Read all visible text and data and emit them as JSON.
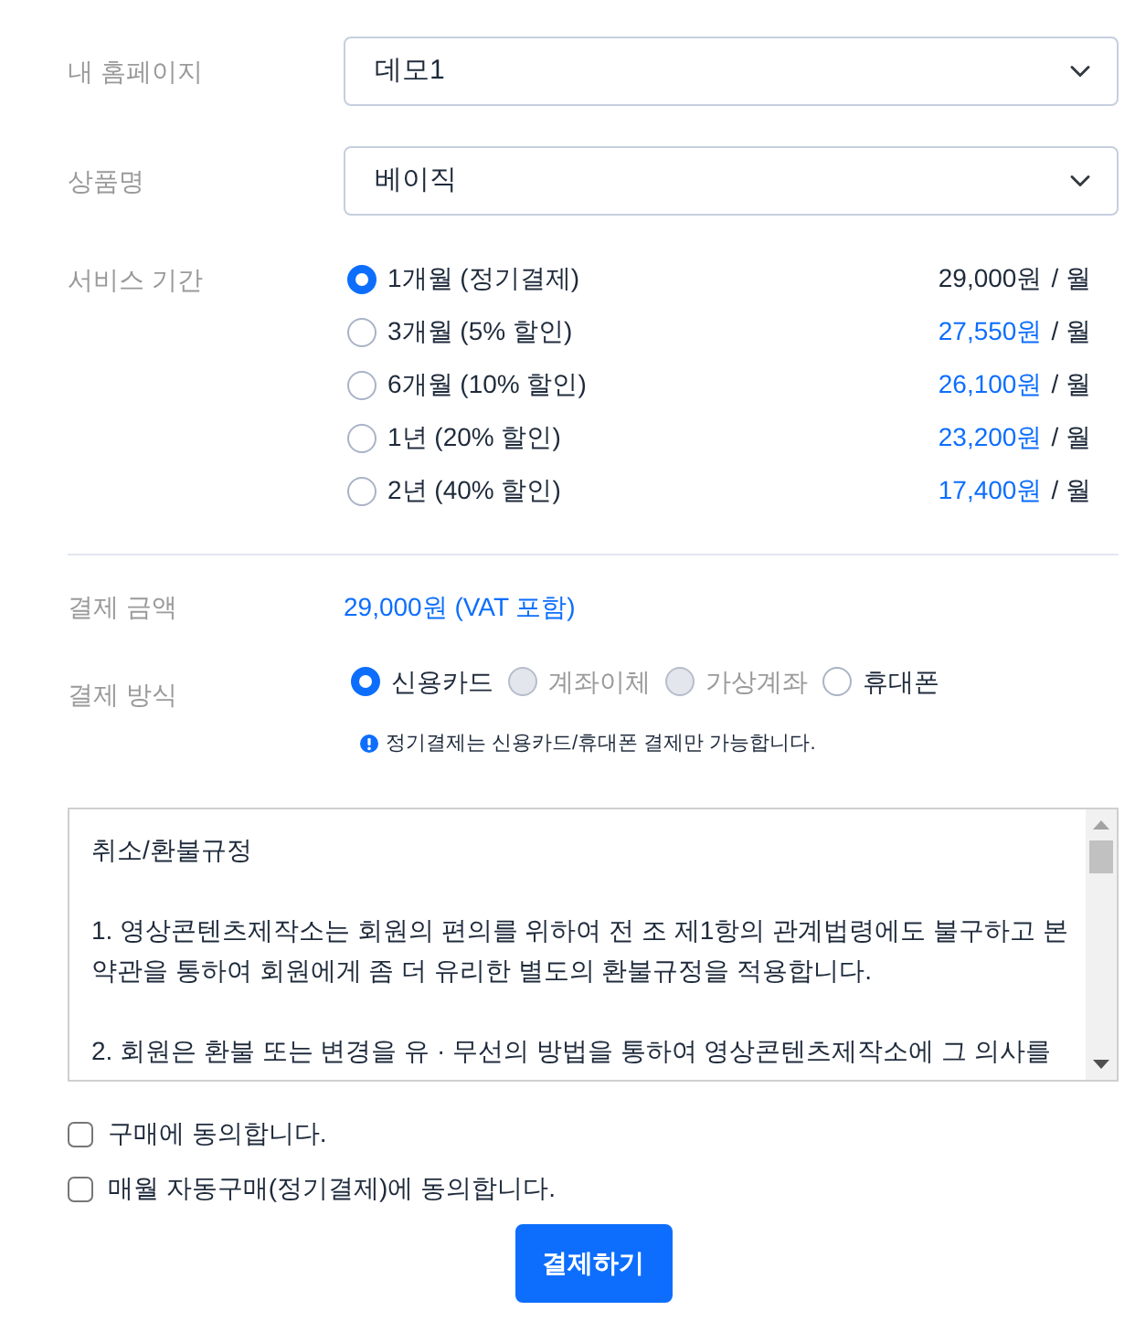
{
  "fields": [
    {
      "kind": "select",
      "label": "내 홈페이지",
      "value": "데모1"
    },
    {
      "kind": "select",
      "label": "상품명",
      "value": "베이직"
    }
  ],
  "service_period": {
    "label": "서비스 기간",
    "options": [
      {
        "label": "1개월 (정기결제)",
        "price": "29,000원",
        "unit": "/ 월",
        "color": "#1e2a3b",
        "selected": true
      },
      {
        "label": "3개월 (5% 할인)",
        "price": "27,550원",
        "unit": "/ 월",
        "color": "#0d6efd",
        "selected": false
      },
      {
        "label": "6개월 (10% 할인)",
        "price": "26,100원",
        "unit": "/ 월",
        "color": "#0d6efd",
        "selected": false
      },
      {
        "label": "1년 (20% 할인)",
        "price": "23,200원",
        "unit": "/ 월",
        "color": "#0d6efd",
        "selected": false
      },
      {
        "label": "2년 (40% 할인)",
        "price": "17,400원",
        "unit": "/ 월",
        "color": "#0d6efd",
        "selected": false
      }
    ]
  },
  "payment_amount": {
    "label": "결제 금액",
    "value": "29,000원 (VAT 포함)"
  },
  "payment_method": {
    "label": "결제 방식",
    "options": [
      {
        "label": "신용카드",
        "selected": true,
        "disabled": false
      },
      {
        "label": "계좌이체",
        "selected": false,
        "disabled": true
      },
      {
        "label": "가상계좌",
        "selected": false,
        "disabled": true
      },
      {
        "label": "휴대폰",
        "selected": false,
        "disabled": false
      }
    ],
    "notice": "정기결제는 신용카드/휴대폰 결제만 가능합니다."
  },
  "terms": {
    "title": "취소/환불규정",
    "paragraphs": [
      "1. 영상콘텐츠제작소는 회원의 편의를 위하여 전 조 제1항의 관계법령에도 불구하고 본 약관을 통하여 회원에게 좀 더 유리한 별도의 환불규정을 적용합니다.",
      "2. 회원은 환불 또는 변경을 유 · 무선의 방법을 통하여 영상콘텐츠제작소에 그 의사를"
    ]
  },
  "agreements": [
    {
      "label": "구매에 동의합니다.",
      "checked": false
    },
    {
      "label": "매월 자동구매(정기결제)에 동의합니다.",
      "checked": false
    }
  ],
  "submit_button": "결제하기"
}
